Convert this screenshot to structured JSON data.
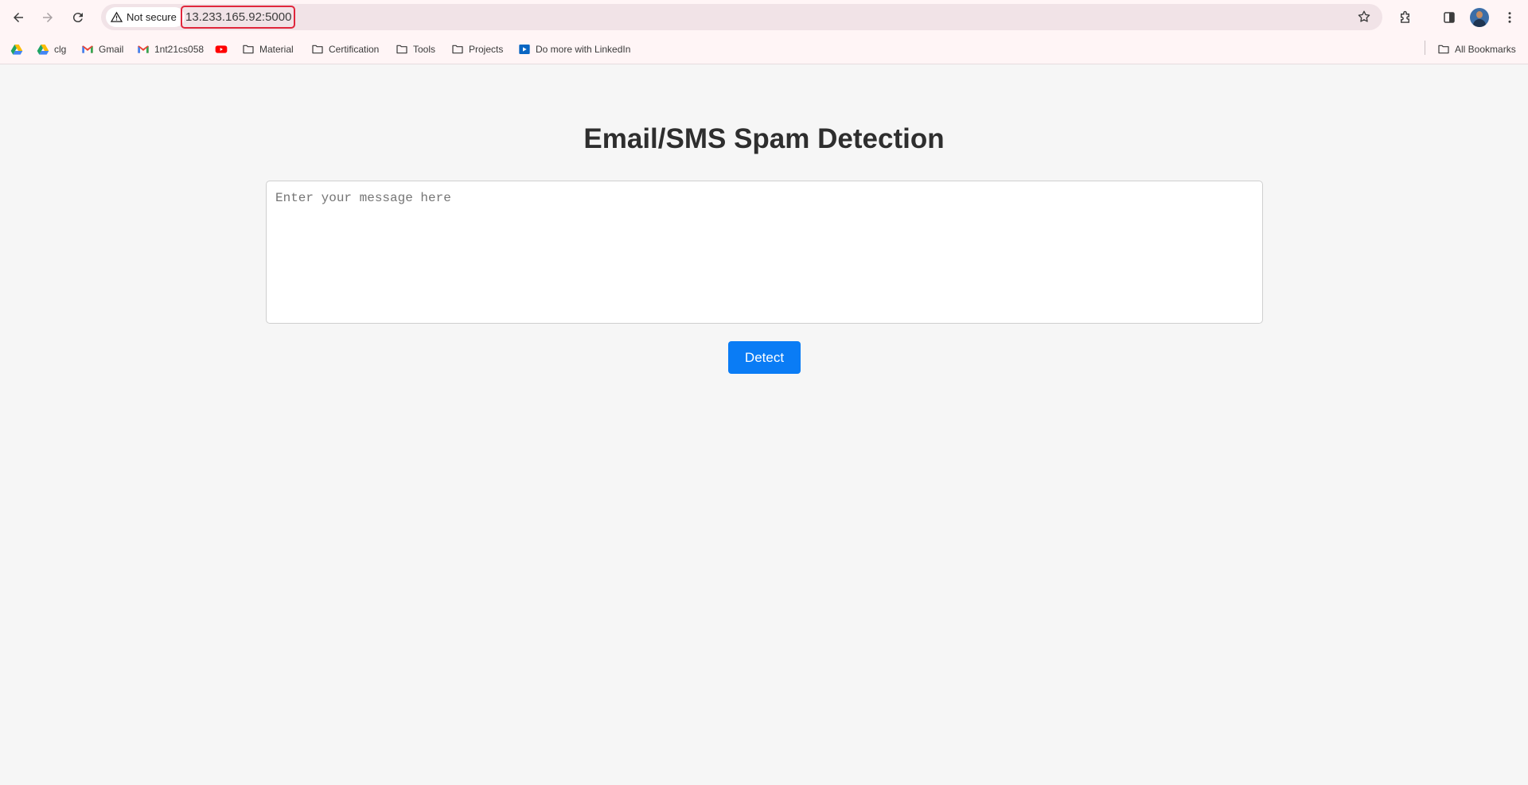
{
  "browser": {
    "security_label": "Not secure",
    "url": "13.233.165.92:5000"
  },
  "bookmarks": [
    {
      "label": "",
      "icon": "google-drive-icon"
    },
    {
      "label": "clg",
      "icon": "google-drive-icon"
    },
    {
      "label": "Gmail",
      "icon": "gmail-icon"
    },
    {
      "label": "1nt21cs058",
      "icon": "gmail-icon"
    },
    {
      "label": "",
      "icon": "youtube-icon"
    },
    {
      "label": "Material",
      "icon": "folder-icon"
    },
    {
      "label": "Certification",
      "icon": "folder-icon"
    },
    {
      "label": "Tools",
      "icon": "folder-icon"
    },
    {
      "label": "Projects",
      "icon": "folder-icon"
    },
    {
      "label": "Do more with LinkedIn",
      "icon": "linkedin-learning-icon"
    }
  ],
  "all_bookmarks_label": "All Bookmarks",
  "page": {
    "title": "Email/SMS Spam Detection",
    "input_placeholder": "Enter your message here",
    "input_value": "",
    "button_label": "Detect"
  },
  "colors": {
    "button": "#0a7cf5",
    "highlight": "#e0263c",
    "background": "#f6f6f6"
  }
}
